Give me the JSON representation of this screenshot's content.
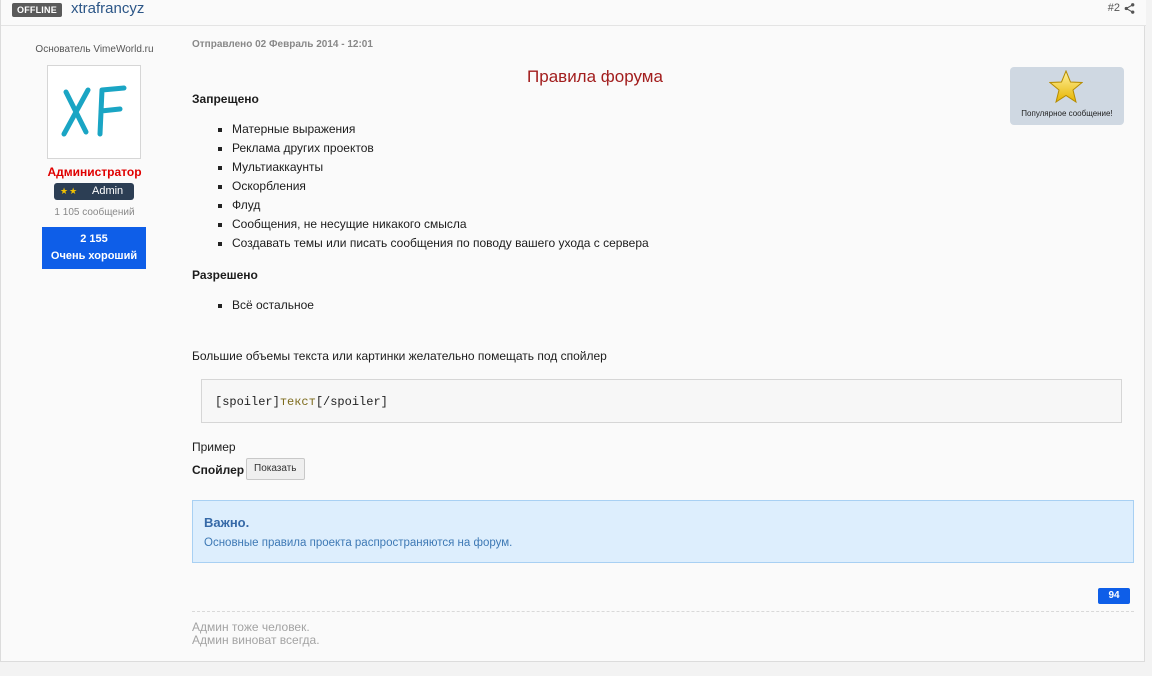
{
  "header": {
    "status_badge": "OFFLINE",
    "username": "xtrafrancyz",
    "post_number": "#2"
  },
  "author": {
    "group_title": "Основатель VimeWorld.ru",
    "avatar_text": "XF",
    "role": "Администратор",
    "rank_stars": "★★",
    "rank_label": "Admin",
    "posts_count": "1 105 сообщений",
    "reputation_value": "2 155",
    "reputation_label": "Очень хороший"
  },
  "post": {
    "date": "Отправлено 02 Февраль 2014 - 12:01",
    "popular_badge": "Популярное сообщение!",
    "title": "Правила форума",
    "forbidden_heading": "Запрещено",
    "forbidden": [
      "Матерные выражения",
      "Реклама других проектов",
      "Мультиаккаунты",
      "Оскорбления",
      "Флуд",
      "Сообщения, не несущие никакого смысла",
      "Создавать темы или писать сообщения по поводу вашего ухода с сервера"
    ],
    "allowed_heading": "Разрешено",
    "allowed": [
      "Всё остальное"
    ],
    "note": "Большие объемы текста или картинки желательно помещать под спойлер",
    "code": {
      "open_tag": "[spoiler]",
      "text": "текст",
      "close_tag": "[/spoiler]"
    },
    "example_label": "Пример",
    "spoiler_label": "Спойлер",
    "spoiler_button": "Показать",
    "important_title": "Важно.",
    "important_text": "Основные правила проекта распространяются на форум.",
    "reputation_count": "94",
    "signature_line1": "Админ тоже человек.",
    "signature_line2": "Админ виноват всегда."
  },
  "colors": {
    "accent_blue": "#0e5ee8",
    "admin_red": "#e00000",
    "title_red": "#a21d1d",
    "info_bg": "#ddeefd"
  }
}
